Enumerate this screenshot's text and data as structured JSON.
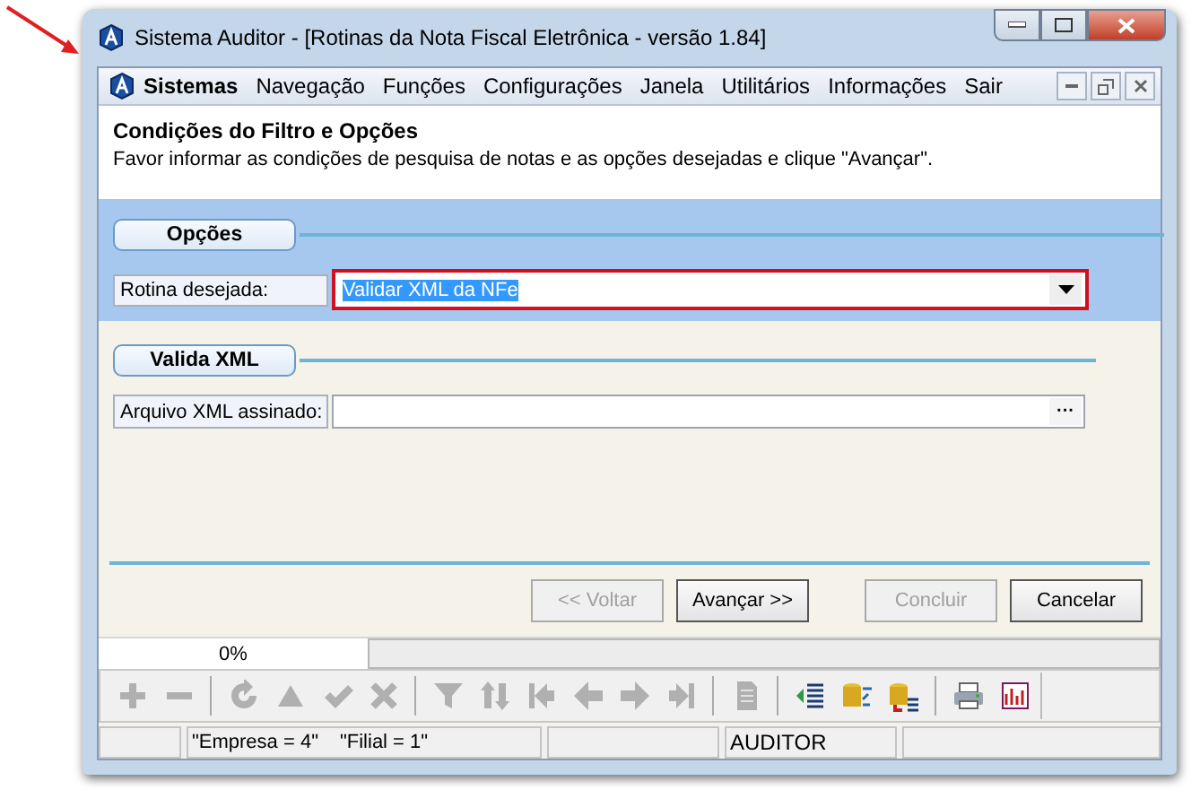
{
  "window": {
    "title": "Sistema Auditor - [Rotinas da Nota Fiscal Eletrônica - versão 1.84]"
  },
  "menu": [
    {
      "label": "Sistemas",
      "kind": "app"
    },
    {
      "label": "Navegação",
      "kind": "menu"
    },
    {
      "label": "Funções",
      "kind": "menu"
    },
    {
      "label": "Configurações",
      "kind": "menu"
    },
    {
      "label": "Janela",
      "kind": "menu"
    },
    {
      "label": "Utilitários",
      "kind": "menu"
    },
    {
      "label": "Informações",
      "kind": "menu"
    },
    {
      "label": "Sair",
      "kind": "menu"
    }
  ],
  "header": {
    "title": "Condições do Filtro e Opções",
    "subtitle": "Favor informar as condições de pesquisa de notas e as opções desejadas e clique \"Avançar\"."
  },
  "options": {
    "group": "Opções",
    "label": "Rotina desejada:",
    "value": "Validar XML da NFe",
    "focused": true,
    "highlighted": true
  },
  "validate": {
    "group": "Valida XML",
    "label": "Arquivo XML assinado:",
    "browse": "···"
  },
  "buttons": [
    {
      "label": "<< Voltar",
      "disabled": true
    },
    {
      "label": "Avançar >>",
      "disabled": false
    },
    {
      "label": "Concluir",
      "disabled": true
    },
    {
      "label": "Cancelar",
      "disabled": false
    }
  ],
  "progress": {
    "reading": "0%",
    "level": 0
  },
  "toolbar": [
    {
      "kind": "plus",
      "disabled": true
    },
    {
      "kind": "minus",
      "disabled": true
    },
    {
      "kind": "sep"
    },
    {
      "kind": "refresh",
      "disabled": true
    },
    {
      "kind": "up",
      "disabled": true
    },
    {
      "kind": "check",
      "disabled": true
    },
    {
      "kind": "cross",
      "disabled": true
    },
    {
      "kind": "sep"
    },
    {
      "kind": "filter",
      "disabled": true
    },
    {
      "kind": "sort",
      "disabled": true
    },
    {
      "kind": "first",
      "disabled": true
    },
    {
      "kind": "prev",
      "disabled": true
    },
    {
      "kind": "next",
      "disabled": true
    },
    {
      "kind": "last",
      "disabled": true
    },
    {
      "kind": "sep"
    },
    {
      "kind": "doc",
      "disabled": true
    },
    {
      "kind": "sep"
    },
    {
      "kind": "list",
      "disabled": false
    },
    {
      "kind": "dbswap",
      "disabled": false
    },
    {
      "kind": "dblist",
      "disabled": false
    },
    {
      "kind": "sep"
    },
    {
      "kind": "print",
      "disabled": false
    },
    {
      "kind": "chart",
      "disabled": false
    }
  ],
  "status_bar": {
    "company": "\"Empresa = 4\"",
    "branch": "\"Filial = 1\"",
    "user": "AUDITOR"
  }
}
